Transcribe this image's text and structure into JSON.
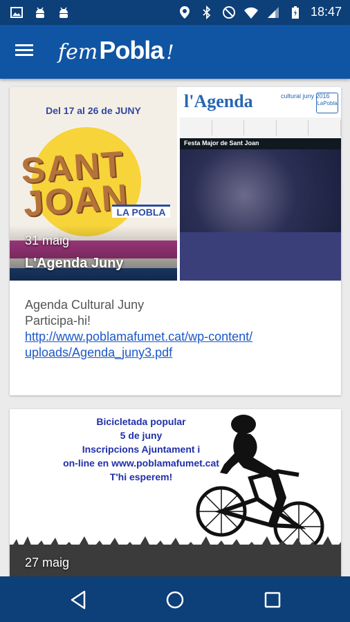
{
  "status_bar": {
    "time": "18:47",
    "left_icons": [
      "image-icon",
      "android-icon",
      "android-icon"
    ],
    "right_icons": [
      "location-icon",
      "bluetooth-icon",
      "do-not-disturb-icon",
      "wifi-icon",
      "signal-icon",
      "battery-charging-icon"
    ]
  },
  "app_bar": {
    "brand_fem": "fem",
    "brand_pobla": "Pobla",
    "brand_excl": "!",
    "menu_icon": "hamburger-menu-icon"
  },
  "feed": {
    "posts": [
      {
        "date": "31 maig",
        "title": "L'Agenda Juny",
        "image_left": {
          "dates": "Del 17 al 26 de JUNY",
          "headline": "SANT JOAN",
          "tag": "LA POBLA"
        },
        "image_right": {
          "title": "l'Agenda",
          "subtitle": "cultural juny 2016",
          "logo": "LaPobla",
          "banner": "Festa Major de Sant Joan"
        },
        "body_line1": "Agenda Cultural Juny",
        "body_line2": "Participa-hi!",
        "link": "http://www.poblamafumet.cat/wp-content/uploads/Agenda_juny3.pdf",
        "link_line1": "http://www.poblamafumet.cat/wp-content/",
        "link_line2": "uploads/Agenda_juny3.pdf"
      },
      {
        "date": "27 maig",
        "image_text": [
          "Bicicletada popular",
          "5 de juny",
          "Inscripcions Ajuntament i",
          "on-line en www.poblamafumet.cat",
          "T'hi esperem!"
        ]
      }
    ]
  },
  "nav_bar": {
    "back_icon": "back-triangle-icon",
    "home_icon": "home-circle-icon",
    "recents_icon": "recents-square-icon"
  },
  "colors": {
    "status_bar": "#0d3f78",
    "app_bar": "#1055a3",
    "link": "#1a58c7",
    "background": "#ebebeb"
  }
}
